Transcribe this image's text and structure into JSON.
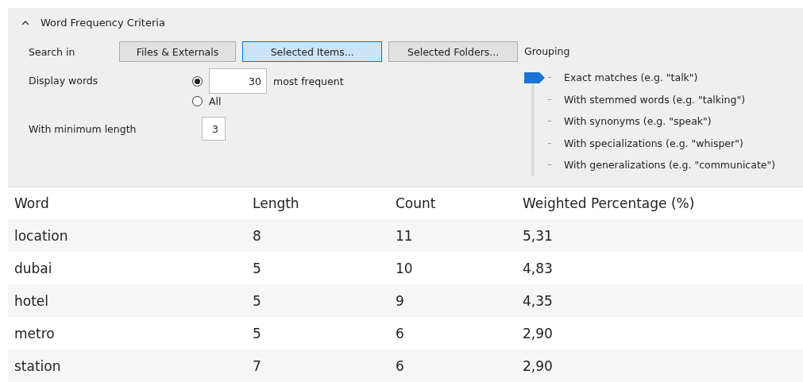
{
  "criteria": {
    "title": "Word Frequency Criteria",
    "expanded": true,
    "search_in": {
      "label": "Search in",
      "buttons": [
        {
          "label": "Files & Externals",
          "selected": false
        },
        {
          "label": "Selected Items...",
          "selected": true
        },
        {
          "label": "Selected Folders...",
          "selected": false
        }
      ]
    },
    "display_words": {
      "label": "Display words",
      "options": [
        {
          "kind": "count",
          "selected": true,
          "value": "30",
          "suffix": "most frequent"
        },
        {
          "kind": "all",
          "selected": false,
          "label": "All"
        }
      ]
    },
    "min_length": {
      "label": "With minimum length",
      "value": "3"
    },
    "grouping": {
      "label": "Grouping",
      "options": [
        {
          "label": "Exact matches (e.g. \"talk\")",
          "selected": true
        },
        {
          "label": "With stemmed words (e.g. \"talking\")",
          "selected": false
        },
        {
          "label": "With synonyms (e.g. \"speak\")",
          "selected": false
        },
        {
          "label": "With specializations (e.g. \"whisper\")",
          "selected": false
        },
        {
          "label": "With generalizations (e.g. \"communicate\")",
          "selected": false
        }
      ]
    }
  },
  "table": {
    "columns": [
      "Word",
      "Length",
      "Count",
      "Weighted Percentage (%)"
    ],
    "rows": [
      [
        "location",
        "8",
        "11",
        "5,31"
      ],
      [
        "dubai",
        "5",
        "10",
        "4,83"
      ],
      [
        "hotel",
        "5",
        "9",
        "4,35"
      ],
      [
        "metro",
        "5",
        "6",
        "2,90"
      ],
      [
        "station",
        "7",
        "6",
        "2,90"
      ]
    ]
  }
}
